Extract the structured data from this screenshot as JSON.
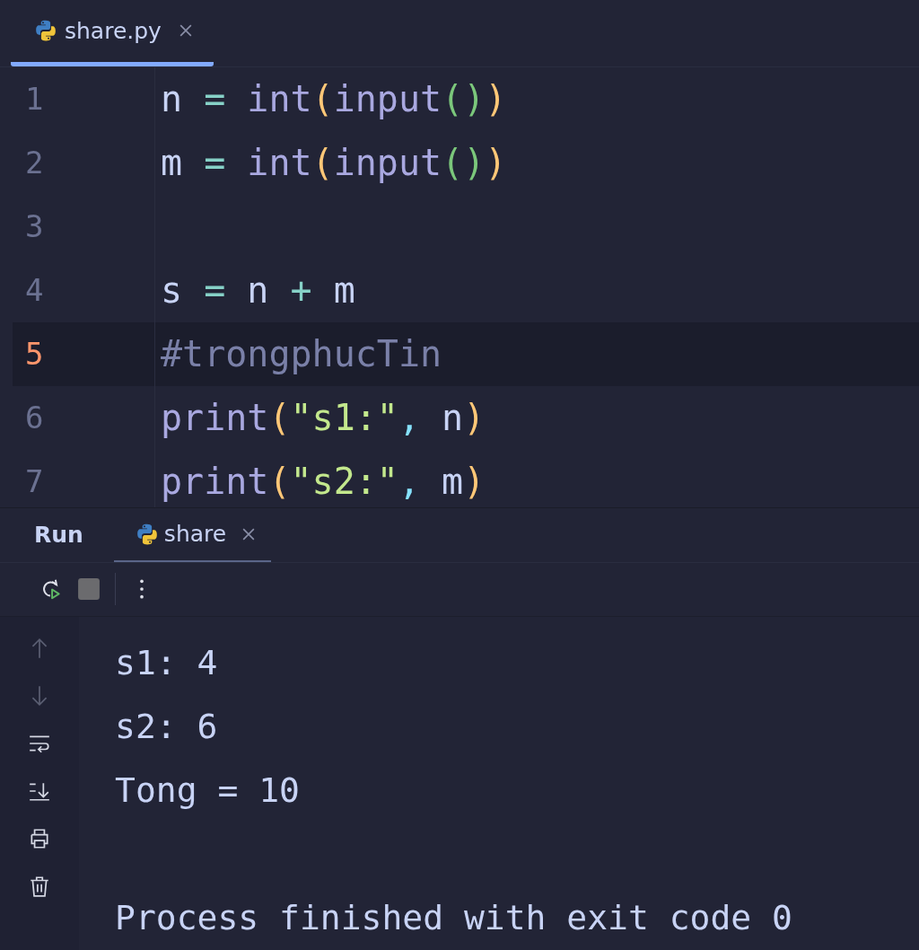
{
  "editor": {
    "tabs": [
      {
        "label": "share.py",
        "selected": true
      }
    ],
    "lines": [
      {
        "number": "1",
        "current": false,
        "tokens": [
          {
            "text": "n ",
            "kind": "var"
          },
          {
            "text": "= ",
            "kind": "op"
          },
          {
            "text": "int",
            "kind": "func"
          },
          {
            "text": "(",
            "kind": "paren1"
          },
          {
            "text": "input",
            "kind": "func"
          },
          {
            "text": "()",
            "kind": "paren2"
          },
          {
            "text": ")",
            "kind": "paren1"
          }
        ]
      },
      {
        "number": "2",
        "current": false,
        "tokens": [
          {
            "text": "m ",
            "kind": "var"
          },
          {
            "text": "= ",
            "kind": "op"
          },
          {
            "text": "int",
            "kind": "func"
          },
          {
            "text": "(",
            "kind": "paren1"
          },
          {
            "text": "input",
            "kind": "func"
          },
          {
            "text": "()",
            "kind": "paren2"
          },
          {
            "text": ")",
            "kind": "paren1"
          }
        ]
      },
      {
        "number": "3",
        "current": false
      },
      {
        "number": "4",
        "current": false,
        "tokens": [
          {
            "text": "s ",
            "kind": "var"
          },
          {
            "text": "= ",
            "kind": "op"
          },
          {
            "text": "n ",
            "kind": "var"
          },
          {
            "text": "+ ",
            "kind": "op"
          },
          {
            "text": "m",
            "kind": "var"
          }
        ]
      },
      {
        "number": "5",
        "current": true,
        "tokens": [
          {
            "text": "#trongphucTin",
            "kind": "comment"
          }
        ]
      },
      {
        "number": "6",
        "current": false,
        "tokens": [
          {
            "text": "print",
            "kind": "func"
          },
          {
            "text": "(",
            "kind": "paren1"
          },
          {
            "text": "\"s1:\"",
            "kind": "string"
          },
          {
            "text": ", ",
            "kind": "comma"
          },
          {
            "text": "n",
            "kind": "var"
          },
          {
            "text": ")",
            "kind": "paren1"
          }
        ]
      },
      {
        "number": "7",
        "current": false,
        "tokens": [
          {
            "text": "print",
            "kind": "func"
          },
          {
            "text": "(",
            "kind": "paren1"
          },
          {
            "text": "\"s2:\"",
            "kind": "string"
          },
          {
            "text": ", ",
            "kind": "comma"
          },
          {
            "text": "m",
            "kind": "var"
          },
          {
            "text": ")",
            "kind": "paren1"
          }
        ]
      }
    ]
  },
  "run_panel": {
    "title": "Run",
    "tabs": [
      {
        "label": "share",
        "selected": true
      }
    ],
    "toolbar": [
      {
        "kind": "rerun"
      },
      {
        "kind": "stop"
      },
      {
        "kind": "separator"
      },
      {
        "kind": "more"
      }
    ],
    "side_tools": [
      {
        "kind": "up",
        "disabled": true
      },
      {
        "kind": "down",
        "disabled": true
      },
      {
        "kind": "wrap",
        "disabled": false
      },
      {
        "kind": "scroll-end",
        "disabled": false
      },
      {
        "kind": "print",
        "disabled": false
      },
      {
        "kind": "trash",
        "disabled": false
      }
    ],
    "output": [
      {
        "kind": "text",
        "text": "s1: 4"
      },
      {
        "kind": "text",
        "text": "s2: 6"
      },
      {
        "kind": "text",
        "text": "Tong = 10"
      },
      {
        "kind": "blank"
      },
      {
        "kind": "text",
        "text": "Process finished with exit code 0"
      }
    ]
  }
}
